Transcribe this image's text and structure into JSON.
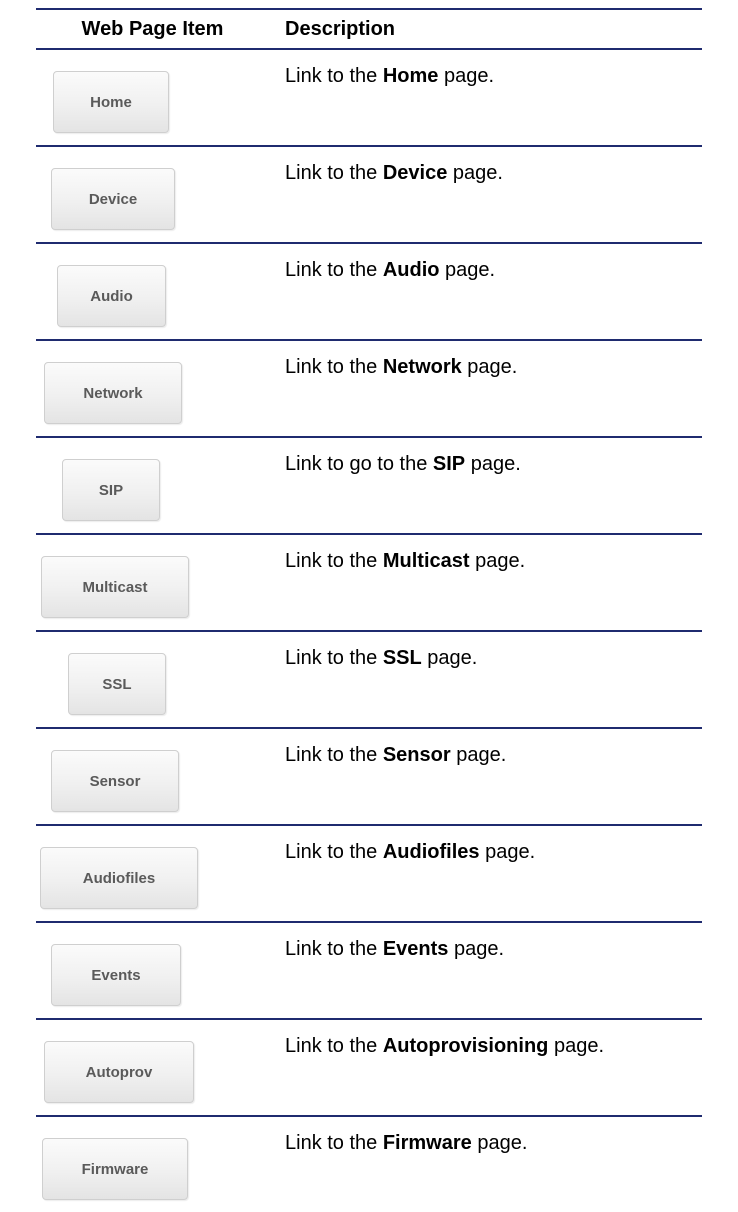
{
  "header": {
    "item_col": "Web Page Item",
    "desc_col": "Description"
  },
  "rows": [
    {
      "button": "Home",
      "prefix": "Link to the ",
      "bold": "Home",
      "suffix": " page."
    },
    {
      "button": "Device",
      "prefix": "Link to the ",
      "bold": "Device",
      "suffix": " page."
    },
    {
      "button": "Audio",
      "prefix": "Link to the ",
      "bold": "Audio",
      "suffix": " page."
    },
    {
      "button": "Network",
      "prefix": "Link to the ",
      "bold": "Network",
      "suffix": " page."
    },
    {
      "button": "SIP",
      "prefix": "Link to go to the ",
      "bold": "SIP",
      "suffix": " page."
    },
    {
      "button": "Multicast",
      "prefix": "Link to the ",
      "bold": "Multicast",
      "suffix": " page."
    },
    {
      "button": "SSL",
      "prefix": "Link to the ",
      "bold": "SSL",
      "suffix": " page."
    },
    {
      "button": "Sensor",
      "prefix": "Link to the ",
      "bold": "Sensor",
      "suffix": " page."
    },
    {
      "button": "Audiofiles",
      "prefix": "Link to the ",
      "bold": "Audiofiles",
      "suffix": " page."
    },
    {
      "button": "Events",
      "prefix": "Link to the ",
      "bold": "Events",
      "suffix": " page."
    },
    {
      "button": "Autoprov",
      "prefix": "Link to the ",
      "bold": "Autoprovisioning",
      "suffix": " page."
    },
    {
      "button": "Firmware",
      "prefix": "Link to the ",
      "bold": "Firmware",
      "suffix": " page."
    }
  ],
  "colors": {
    "rule": "#1f2b6f",
    "button_text": "#5a5a5a"
  }
}
